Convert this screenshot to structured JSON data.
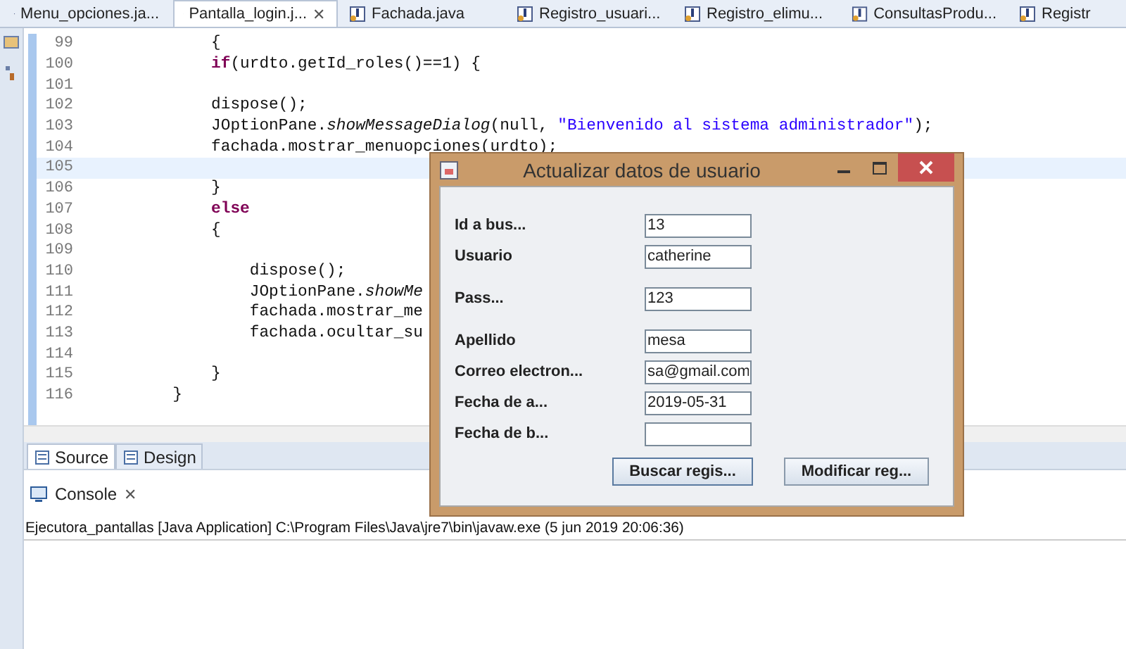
{
  "editor_tabs": [
    {
      "label": "Menu_opciones.ja...",
      "selected": false
    },
    {
      "label": "Pantalla_login.j...",
      "selected": true,
      "close": "✕"
    },
    {
      "label": "Fachada.java",
      "selected": false
    },
    {
      "label": "Registro_usuari...",
      "selected": false
    },
    {
      "label": "Registro_elimu...",
      "selected": false
    },
    {
      "label": "ConsultasProdu...",
      "selected": false
    },
    {
      "label": "Registr",
      "selected": false
    }
  ],
  "code_lines": [
    {
      "number": "99",
      "current": false,
      "tokens": [
        {
          "kind": "plain",
          "text": "            {"
        }
      ]
    },
    {
      "number": "100",
      "current": false,
      "tokens": [
        {
          "kind": "keyword",
          "text": "            if"
        },
        {
          "kind": "plain",
          "text": "(urdto.getId_roles()==1) {"
        }
      ]
    },
    {
      "number": "101",
      "current": false
    },
    {
      "number": "102",
      "current": false,
      "tokens": [
        {
          "kind": "plain",
          "text": "            dispose();"
        }
      ]
    },
    {
      "number": "103",
      "current": false,
      "tokens": [
        {
          "kind": "plain",
          "text": "            JOptionPane."
        },
        {
          "kind": "static",
          "text": "showMessageDialog"
        },
        {
          "kind": "plain",
          "text": "(null, "
        },
        {
          "kind": "string",
          "text": "\"Bienvenido al sistema administrador\""
        },
        {
          "kind": "plain",
          "text": ");"
        }
      ]
    },
    {
      "number": "104",
      "current": false,
      "tokens": [
        {
          "kind": "plain",
          "text": "            fachada.mostrar_menuopciones(urdto);"
        }
      ]
    },
    {
      "number": "105",
      "current": true
    },
    {
      "number": "106",
      "current": false,
      "tokens": [
        {
          "kind": "plain",
          "text": "            }"
        }
      ]
    },
    {
      "number": "107",
      "current": false,
      "tokens": [
        {
          "kind": "keyword",
          "text": "            else"
        }
      ]
    },
    {
      "number": "108",
      "current": false,
      "tokens": [
        {
          "kind": "plain",
          "text": "            {"
        }
      ]
    },
    {
      "number": "109",
      "current": false
    },
    {
      "number": "110",
      "current": false,
      "tokens": [
        {
          "kind": "plain",
          "text": "                dispose();"
        }
      ]
    },
    {
      "number": "111",
      "current": false,
      "tokens": [
        {
          "kind": "plain",
          "text": "                JOptionPane."
        },
        {
          "kind": "static",
          "text": "showMe"
        }
      ]
    },
    {
      "number": "112",
      "current": false,
      "tokens": [
        {
          "kind": "plain",
          "text": "                fachada.mostrar_me"
        }
      ]
    },
    {
      "number": "113",
      "current": false,
      "tokens": [
        {
          "kind": "plain",
          "text": "                fachada.ocultar_su"
        }
      ]
    },
    {
      "number": "114",
      "current": false
    },
    {
      "number": "115",
      "current": false,
      "tokens": [
        {
          "kind": "plain",
          "text": "            }"
        }
      ]
    },
    {
      "number": "116",
      "current": false,
      "tokens": [
        {
          "kind": "plain",
          "text": "        }"
        }
      ]
    }
  ],
  "view_tabs": [
    {
      "label": "Source",
      "selected": true
    },
    {
      "label": "Design",
      "selected": false
    }
  ],
  "console": {
    "title": "Console",
    "close": "✕",
    "output": "Ejecutora_pantallas [Java Application] C:\\Program Files\\Java\\jre7\\bin\\javaw.exe (5 jun 2019 20:06:36)"
  },
  "dialog": {
    "title": "Actualizar datos de usuario",
    "fields": [
      {
        "label": "Id a bus...",
        "value": "13"
      },
      {
        "label": "Usuario",
        "value": "catherine"
      },
      {
        "label": "Pass...",
        "value": "123"
      },
      {
        "label": "Apellido",
        "value": "mesa"
      },
      {
        "label": "Correo electron...",
        "value": "sa@gmail.com"
      },
      {
        "label": "Fecha de a...",
        "value": "2019-05-31"
      },
      {
        "label": "Fecha de b..."
      }
    ],
    "buttons": [
      {
        "label": "Buscar regis...",
        "focused": true
      },
      {
        "label": "Modificar reg...",
        "focused": false
      }
    ]
  }
}
